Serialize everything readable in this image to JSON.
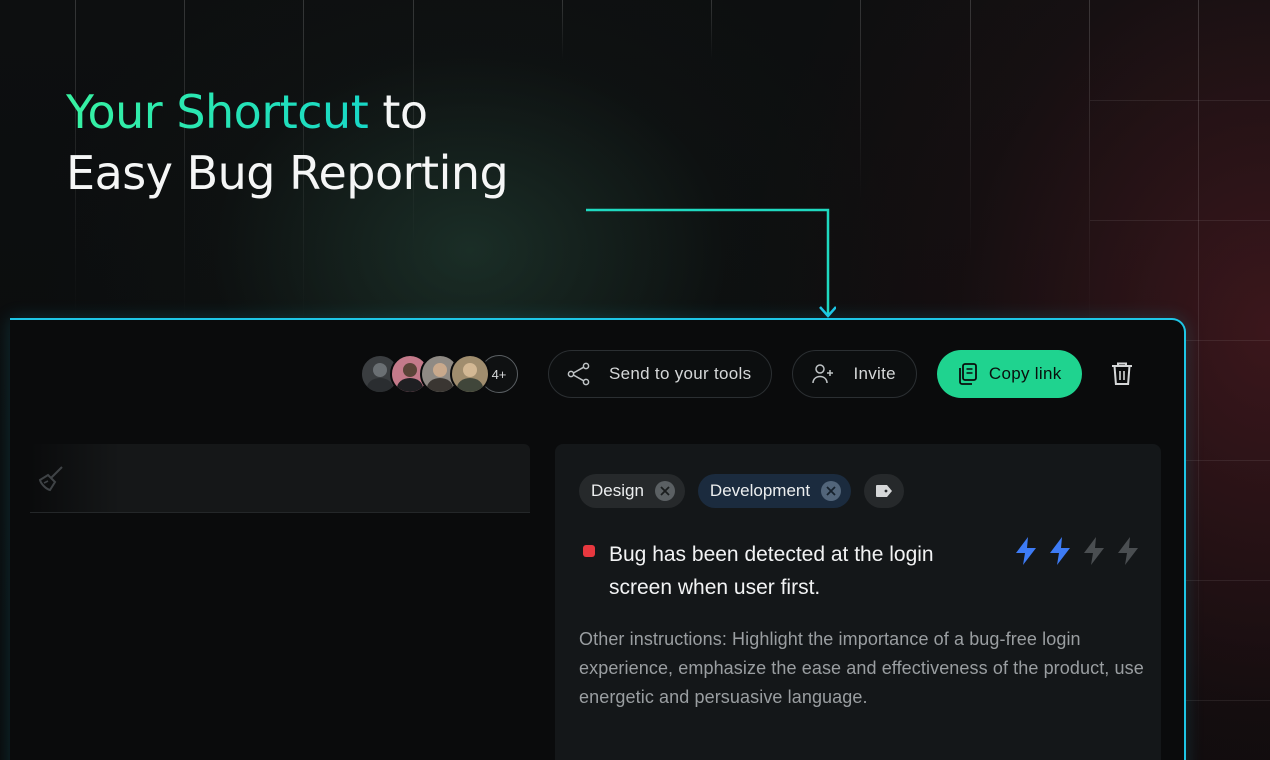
{
  "hero": {
    "headline_accent": "Your Shortcut",
    "headline_rest": " to",
    "headline_line2": "Easy Bug Reporting",
    "accent_color": "#2ee6b0"
  },
  "toolbar": {
    "avatars": [
      {
        "icon": "avatar-1",
        "color": "#6a6f73"
      },
      {
        "icon": "avatar-2",
        "color": "#c47a8a"
      },
      {
        "icon": "avatar-3",
        "color": "#8f8a84"
      },
      {
        "icon": "avatar-4",
        "color": "#a08d6e"
      }
    ],
    "more_count": "4+",
    "send_label": "Send to your tools",
    "invite_label": "Invite",
    "copy_label": "Copy link"
  },
  "report": {
    "tags": [
      {
        "label": "Design"
      },
      {
        "label": "Development"
      }
    ],
    "bug_title": "Bug has been detected at the login screen when user first.",
    "bug_status_color": "#e8383f",
    "priority": {
      "level": 2,
      "max": 4,
      "active_color": "#3d7bf5",
      "inactive_color": "#4a4e51"
    },
    "notes": "Other instructions: Highlight the importance of a bug-free login experience, emphasize the ease and effectiveness of the product, use energetic and persuasive language."
  },
  "colors": {
    "panel_border": "#1ec6e6",
    "copy_button": "#1fd38f"
  }
}
